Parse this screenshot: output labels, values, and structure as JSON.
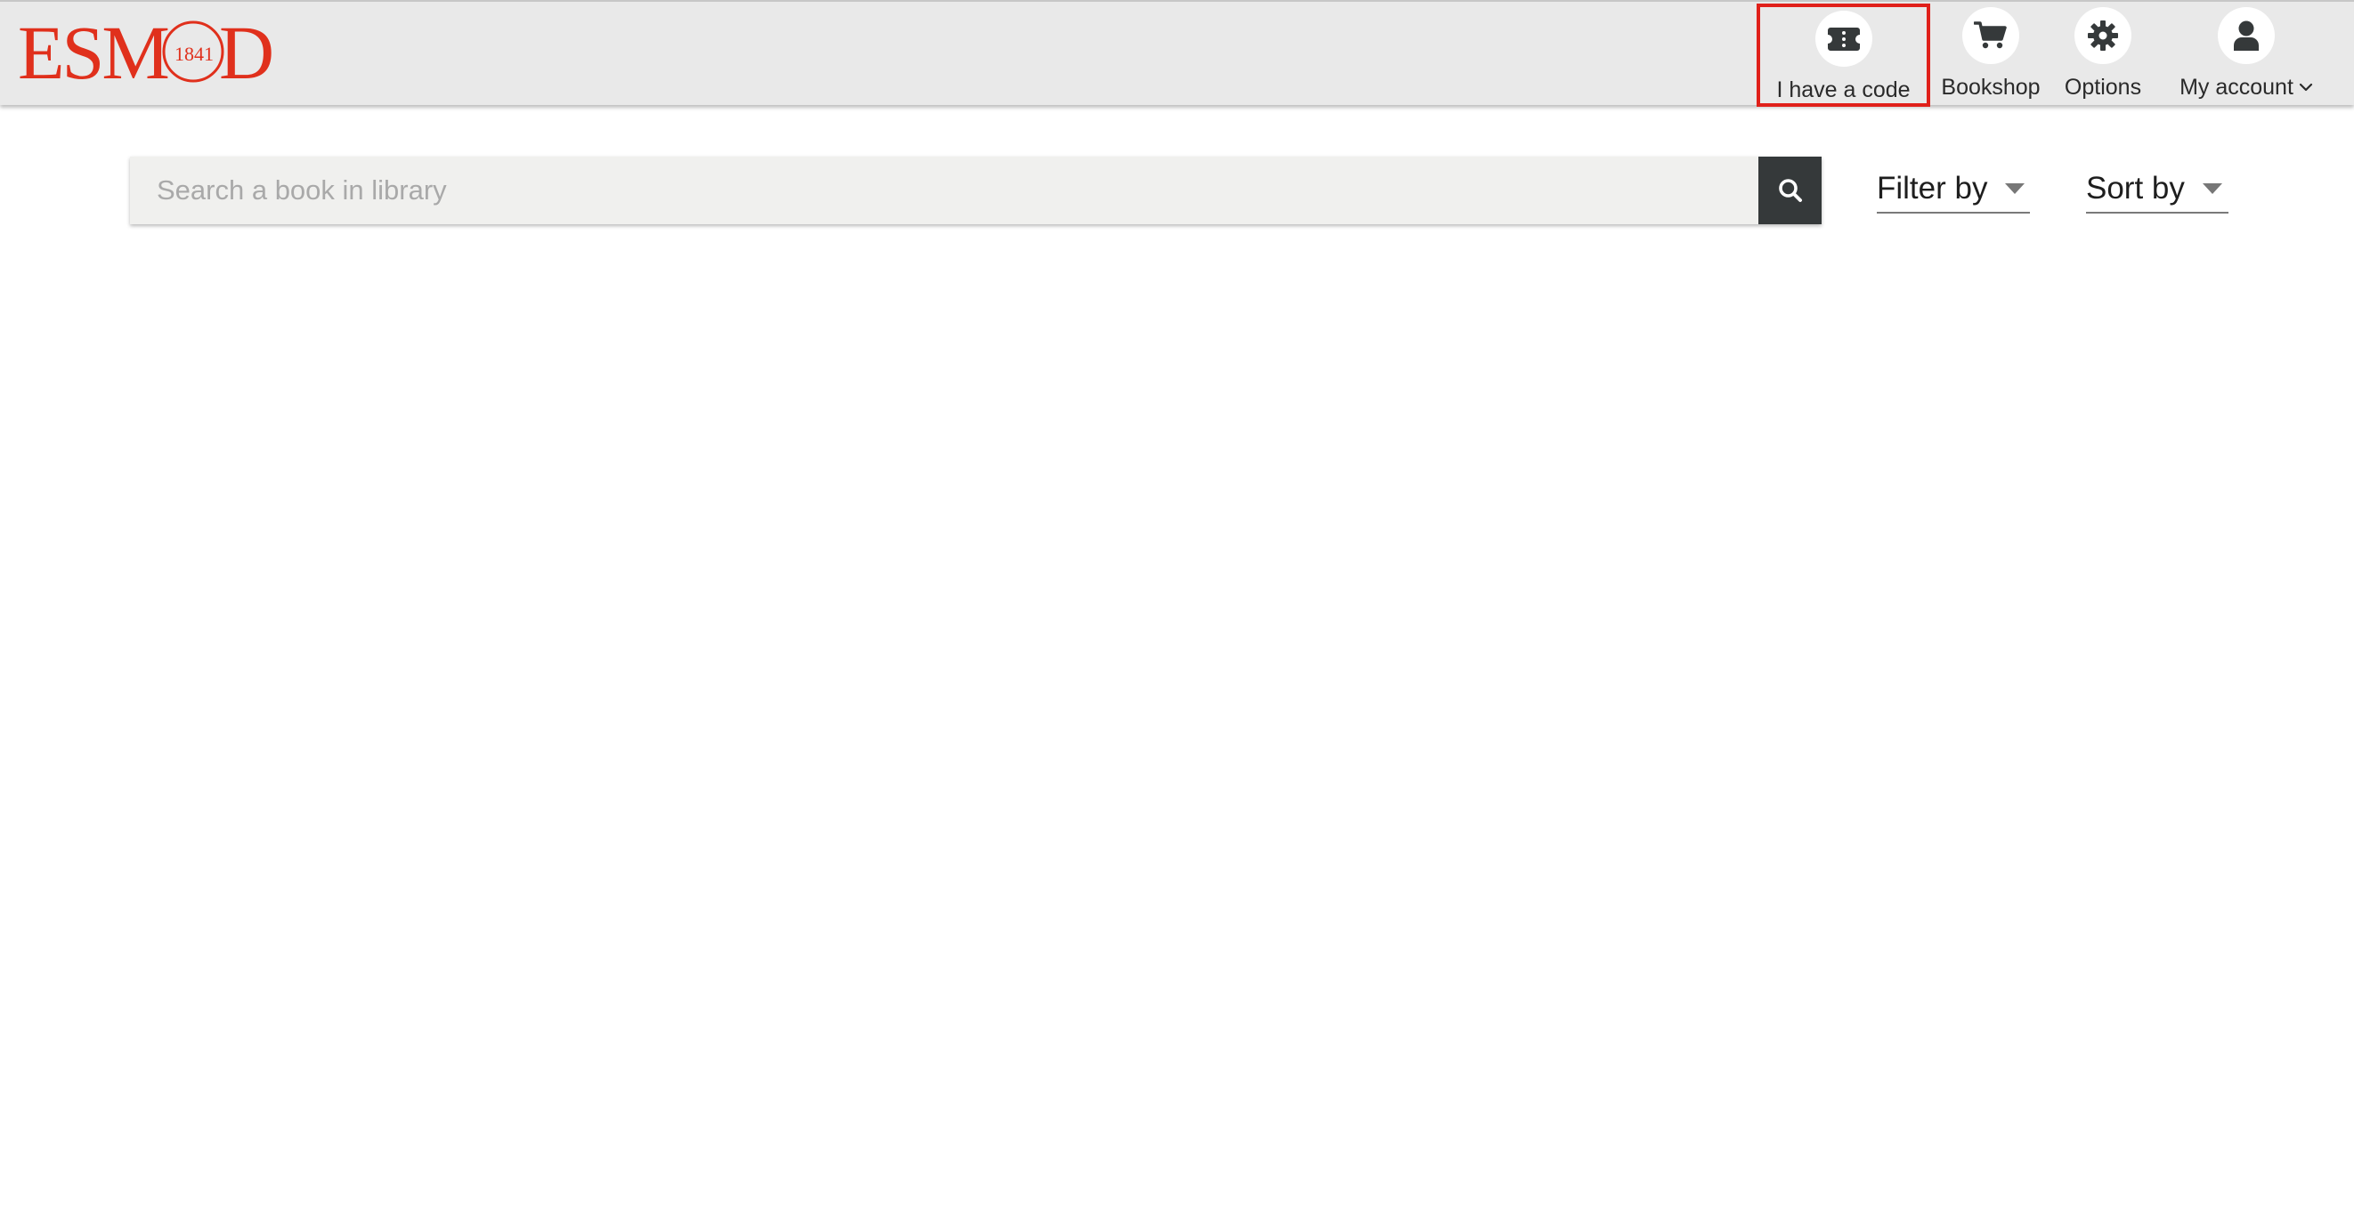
{
  "header": {
    "logo": {
      "text": "ESMOD",
      "year": "1841",
      "color": "#e0301c"
    },
    "nav": {
      "code": {
        "label": "I have a code",
        "icon": "ticket-icon",
        "highlighted": true,
        "highlight_color": "#e0201a"
      },
      "bookshop": {
        "label": "Bookshop",
        "icon": "cart-icon"
      },
      "options": {
        "label": "Options",
        "icon": "gear-icon"
      },
      "account": {
        "label": "My account",
        "icon": "user-icon",
        "chevron": "chevron-down-icon"
      }
    }
  },
  "search": {
    "placeholder": "Search a book in library",
    "value": "",
    "button_icon": "search-icon"
  },
  "filters": {
    "filter_label": "Filter by",
    "sort_label": "Sort by"
  },
  "colors": {
    "header_bg": "#e9e9e9",
    "search_bg": "#f0f0ee",
    "search_button_bg": "#35393a",
    "icon_dark": "#35393a"
  }
}
